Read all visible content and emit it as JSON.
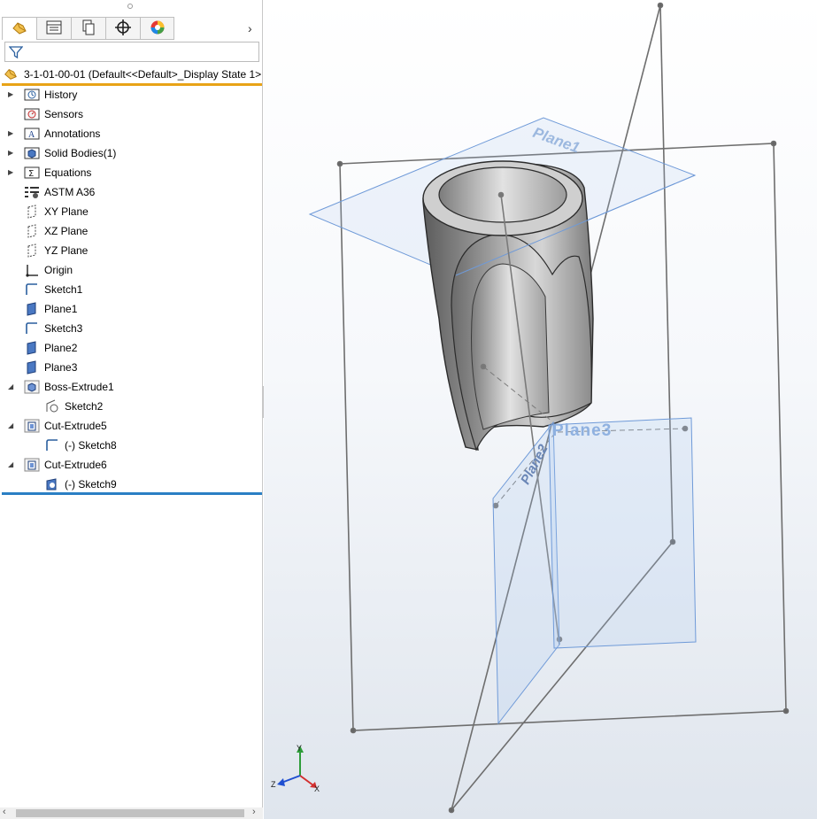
{
  "tree": {
    "root_label": "3-1-01-00-01  (Default<<Default>_Display State 1>",
    "items": [
      {
        "label": "History"
      },
      {
        "label": "Sensors"
      },
      {
        "label": "Annotations"
      },
      {
        "label": "Solid Bodies(1)"
      },
      {
        "label": "Equations"
      },
      {
        "label": "ASTM A36"
      },
      {
        "label": "XY Plane"
      },
      {
        "label": "XZ Plane"
      },
      {
        "label": "YZ Plane"
      },
      {
        "label": "Origin"
      },
      {
        "label": "Sketch1"
      },
      {
        "label": "Plane1"
      },
      {
        "label": "Sketch3"
      },
      {
        "label": "Plane2"
      },
      {
        "label": "Plane3"
      },
      {
        "label": "Boss-Extrude1"
      },
      {
        "label": "Sketch2"
      },
      {
        "label": "Cut-Extrude5"
      },
      {
        "label": "(-) Sketch8"
      },
      {
        "label": "Cut-Extrude6"
      },
      {
        "label": "(-) Sketch9"
      }
    ]
  },
  "viewport": {
    "plane1_label": "Plane1",
    "plane2_label": "Plane2",
    "plane3_label": "Plane3",
    "triad": {
      "x": "X",
      "y": "Y",
      "z": "Z"
    }
  },
  "colors": {
    "accent_orange": "#e8a317",
    "selection_blue": "#2a7fc4",
    "plane_blue": "#5a8fd6"
  }
}
